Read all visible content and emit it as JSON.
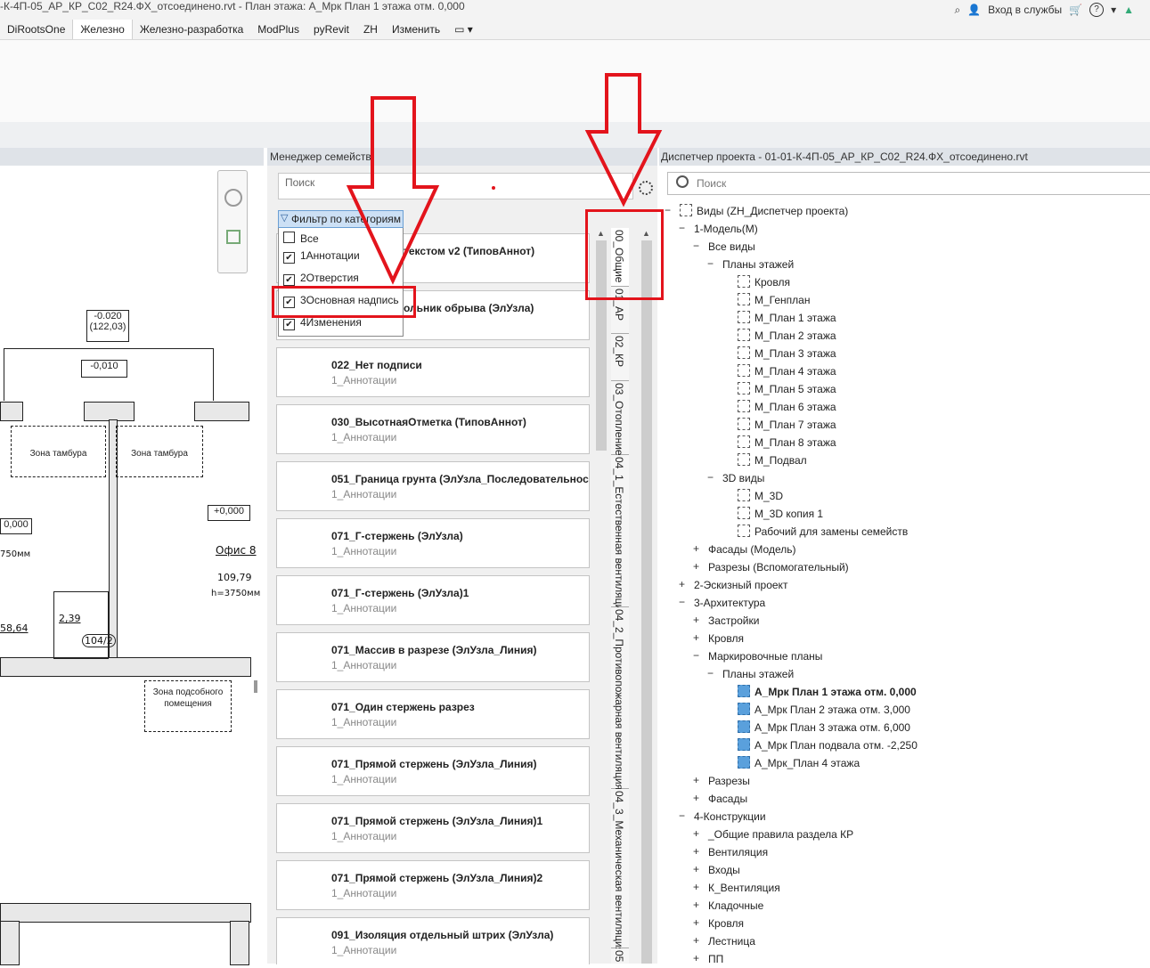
{
  "title_bar": {
    "title": "-К-4П-05_АР_КР_С02_R24.ФХ_отсоединено.rvt - План этажа: А_Мрк План 1 этажа отм. 0,000",
    "sign_in": "Вход в службы",
    "help": "?"
  },
  "ribbon_tabs": [
    "DiRootsOne",
    "Железно",
    "Железно-разработка",
    "ModPlus",
    "pyRevit",
    "ZH",
    "Изменить"
  ],
  "drawing": {
    "level1": "-0.020",
    "level1b": "(122,03)",
    "level2": "-0,010",
    "level3": "+0,000",
    "level4": "0,000",
    "zone1": "Зона тамбура",
    "zone2": "Зона тамбура",
    "zone3": "Зона подсобного помещения",
    "office": "Офис 8",
    "area1": "109,79",
    "height1": "h=3750мм",
    "h_left": "750мм",
    "area2": "58,64",
    "area3": "2,39",
    "room": "104/2"
  },
  "family_manager": {
    "title": "Менеджер семейств",
    "search_placeholder": "Поиск",
    "filter": {
      "header": "Фильтр по категориям",
      "items": [
        {
          "label": "Все",
          "checked": false
        },
        {
          "label": "1Аннотации",
          "checked": true
        },
        {
          "label": "2Отверстия",
          "checked": true
        },
        {
          "label": "3Основная надпись",
          "checked": true
        },
        {
          "label": "4Изменения",
          "checked": true
        }
      ]
    },
    "cards": [
      {
        "name": "текстом v2 (ТиповАннот)",
        "category": ""
      },
      {
        "name": "ольник обрыва (ЭлУзла)",
        "category": ""
      },
      {
        "name": "022_Нет подписи",
        "category": "1_Аннотации"
      },
      {
        "name": "030_ВысотнаяОтметка (ТиповАннот)",
        "category": "1_Аннотации"
      },
      {
        "name": "051_Граница грунта (ЭлУзла_Последовательности",
        "category": "1_Аннотации"
      },
      {
        "name": "071_Г-стержень (ЭлУзла)",
        "category": "1_Аннотации"
      },
      {
        "name": "071_Г-стержень (ЭлУзла)1",
        "category": "1_Аннотации"
      },
      {
        "name": "071_Массив в разрезе (ЭлУзла_Линия)",
        "category": "1_Аннотации"
      },
      {
        "name": "071_Один стержень разрез",
        "category": "1_Аннотации"
      },
      {
        "name": "071_Прямой стержень (ЭлУзла_Линия)",
        "category": "1_Аннотации"
      },
      {
        "name": "071_Прямой стержень (ЭлУзла_Линия)1",
        "category": "1_Аннотации"
      },
      {
        "name": "071_Прямой стержень (ЭлУзла_Линия)2",
        "category": "1_Аннотации"
      },
      {
        "name": "091_Изоляция отдельный штрих (ЭлУзла)",
        "category": "1_Аннотации"
      }
    ],
    "vertical_tabs": [
      "00_Общие",
      "01_АР",
      "02_КР",
      "03_Отопление",
      "04_1_Естественная вентиляция",
      "04_2_Противопожарная вентиляция",
      "04_3_Механическая вентиляция",
      "05"
    ]
  },
  "project_browser": {
    "title": "Диспетчер проекта - 01-01-К-4П-05_АР_КР_С02_R24.ФХ_отсоединено.rvt",
    "search_placeholder": "Поиск",
    "root": "Виды (ZH_Диспетчер проекта)",
    "nodes": [
      {
        "label": "1-Модель(М)",
        "toggle": "−"
      },
      {
        "label": "Все виды",
        "toggle": "−"
      },
      {
        "label": "Планы этажей",
        "toggle": "−"
      },
      {
        "label": "Кровля",
        "toggle": ""
      },
      {
        "label": "М_Генплан",
        "toggle": ""
      },
      {
        "label": "М_План 1 этажа",
        "toggle": ""
      },
      {
        "label": "М_План 2 этажа",
        "toggle": ""
      },
      {
        "label": "М_План 3 этажа",
        "toggle": ""
      },
      {
        "label": "М_План 4 этажа",
        "toggle": ""
      },
      {
        "label": "М_План 5 этажа",
        "toggle": ""
      },
      {
        "label": "М_План 6 этажа",
        "toggle": ""
      },
      {
        "label": "М_План 7 этажа",
        "toggle": ""
      },
      {
        "label": "М_План 8 этажа",
        "toggle": ""
      },
      {
        "label": "М_Подвал",
        "toggle": ""
      },
      {
        "label": "3D виды",
        "toggle": "−"
      },
      {
        "label": "М_3D",
        "toggle": ""
      },
      {
        "label": "М_3D копия 1",
        "toggle": ""
      },
      {
        "label": "Рабочий для замены семейств",
        "toggle": ""
      },
      {
        "label": "Фасады (Модель)",
        "toggle": "+"
      },
      {
        "label": "Разрезы (Вспомогательный)",
        "toggle": "+"
      },
      {
        "label": "2-Эскизный проект",
        "toggle": "+"
      },
      {
        "label": "3-Архитектура",
        "toggle": "−"
      },
      {
        "label": "Застройки",
        "toggle": "+"
      },
      {
        "label": "Кровля",
        "toggle": "+"
      },
      {
        "label": "Маркировочные планы",
        "toggle": "−"
      },
      {
        "label": "Планы этажей",
        "toggle": "−"
      },
      {
        "label": "А_Мрк План 1 этажа отм. 0,000",
        "toggle": ""
      },
      {
        "label": "А_Мрк План 2 этажа отм. 3,000",
        "toggle": ""
      },
      {
        "label": "А_Мрк План 3 этажа отм. 6,000",
        "toggle": ""
      },
      {
        "label": "А_Мрк План подвала отм. -2,250",
        "toggle": ""
      },
      {
        "label": "А_Мрк_План 4 этажа",
        "toggle": ""
      },
      {
        "label": "Разрезы",
        "toggle": "+"
      },
      {
        "label": "Фасады",
        "toggle": "+"
      },
      {
        "label": "4-Конструкции",
        "toggle": "−"
      },
      {
        "label": "_Общие правила раздела КР",
        "toggle": "+"
      },
      {
        "label": "Вентиляция",
        "toggle": "+"
      },
      {
        "label": "Входы",
        "toggle": "+"
      },
      {
        "label": "К_Вентиляция",
        "toggle": "+"
      },
      {
        "label": "Кладочные",
        "toggle": "+"
      },
      {
        "label": "Кровля",
        "toggle": "+"
      },
      {
        "label": "Лестница",
        "toggle": "+"
      },
      {
        "label": "ПП",
        "toggle": "+"
      }
    ]
  },
  "colors": {
    "annotation_red": "#e3141c",
    "view_blue": "#5aa0dc",
    "filter_blue": "#cce0f5"
  }
}
